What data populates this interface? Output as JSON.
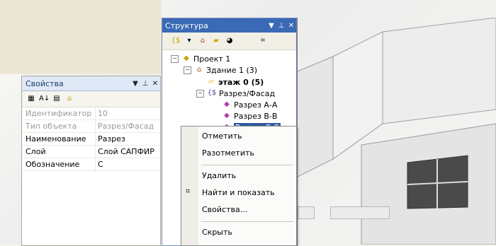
{
  "properties": {
    "title": "Свойства",
    "rows": [
      {
        "key": "Идентификатор",
        "value": "10",
        "disabled": true
      },
      {
        "key": "Тип объекта",
        "value": "Разрез/Фасад",
        "disabled": true
      },
      {
        "key": "Наименование",
        "value": "Разрез",
        "disabled": false
      },
      {
        "key": "Слой",
        "value": "Слой САПФИР",
        "disabled": false
      },
      {
        "key": "Обозначение",
        "value": "С",
        "disabled": false
      }
    ]
  },
  "structure": {
    "title": "Структура",
    "tree": {
      "project": "Проект 1",
      "building": "Здание 1 (3)",
      "floor": "этаж 0 (5)",
      "sections": "Разрез/Фасад",
      "section_a": "Разрез А-А",
      "section_b": "Разрез В-В",
      "section_c": "Разрез С-С"
    }
  },
  "context_menu": {
    "items": [
      "Отметить",
      "Разотметить",
      "Удалить",
      "Найти и показать",
      "Свойства...",
      "Скрыть"
    ]
  },
  "colors": {
    "title_active": "#3a6ab5",
    "title_inactive": "#dfe8f6",
    "selection": "#31599c"
  }
}
